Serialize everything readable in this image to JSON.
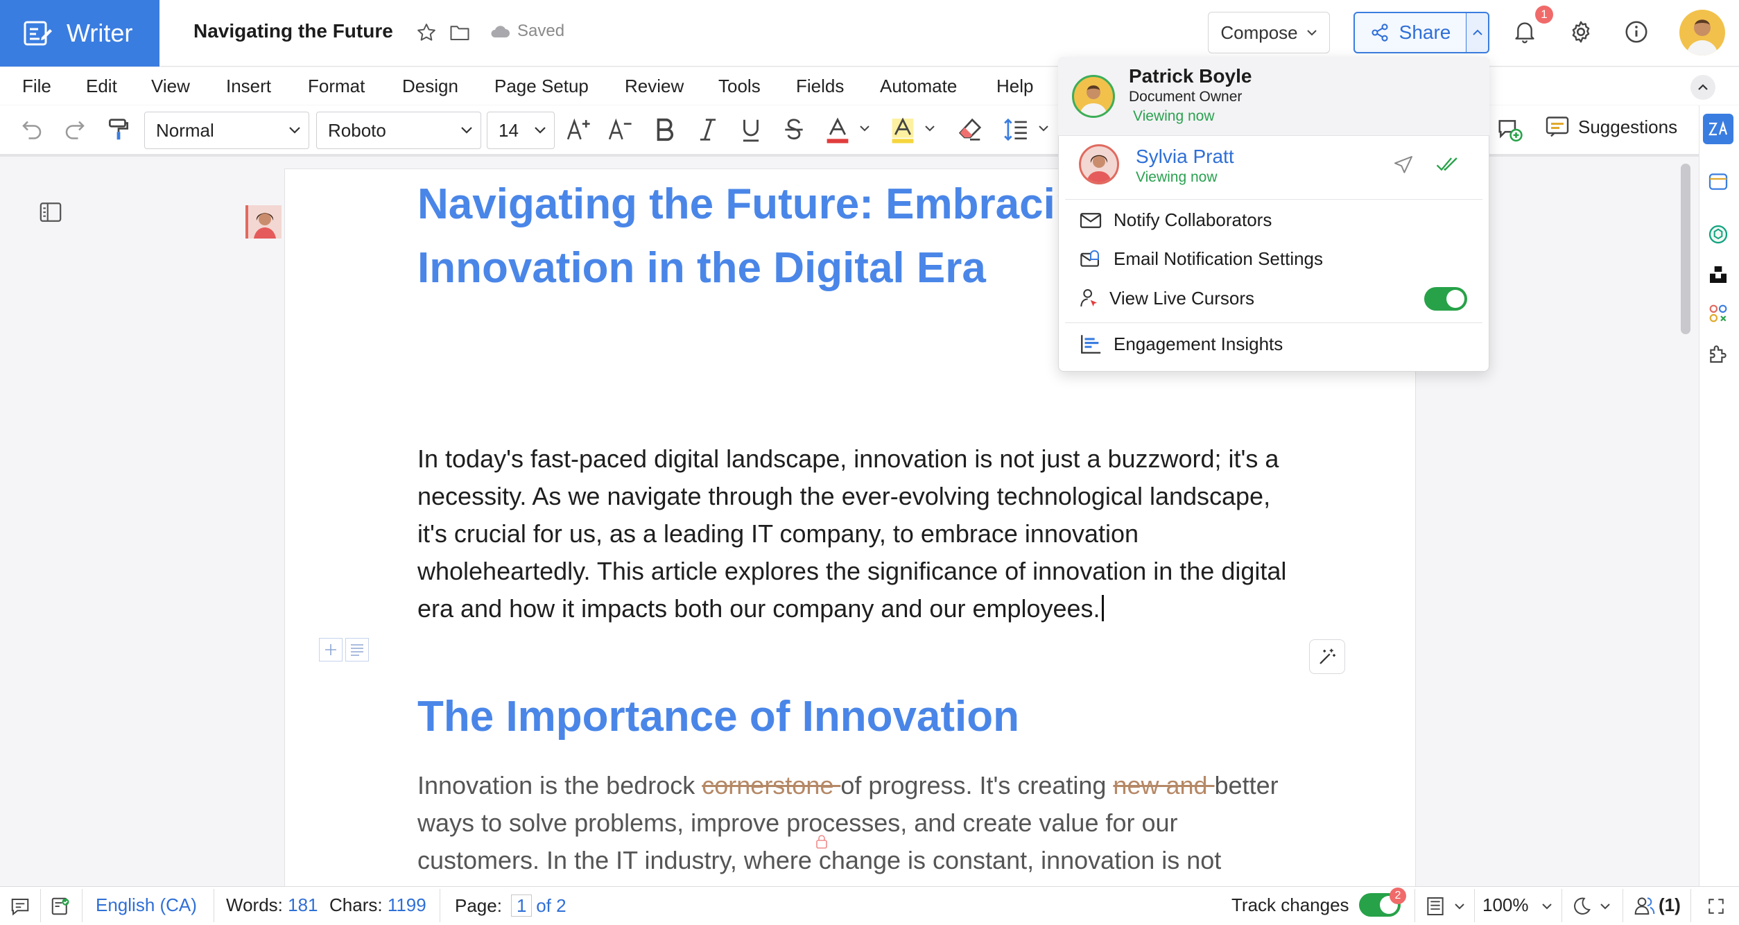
{
  "app": {
    "name": "Writer",
    "doc_title": "Navigating the Future",
    "save_status": "Saved"
  },
  "header": {
    "compose_label": "Compose",
    "share_label": "Share",
    "notification_count": "1"
  },
  "menu": [
    "File",
    "Edit",
    "View",
    "Insert",
    "Format",
    "Design",
    "Page Setup",
    "Review",
    "Tools",
    "Fields",
    "Automate",
    "Help"
  ],
  "toolbar": {
    "style": "Normal",
    "font": "Roboto",
    "size": "14",
    "suggestions_label": "Suggestions",
    "font_color": "#e03c3c",
    "highlight_color": "#f5d63d"
  },
  "share_popup": {
    "owner": {
      "name": "Patrick Boyle",
      "role": "Document Owner",
      "status": "Viewing now"
    },
    "collaborator": {
      "name": "Sylvia Pratt",
      "status": "Viewing now"
    },
    "items": [
      "Notify Collaborators",
      "Email Notification Settings",
      "View Live Cursors",
      "Engagement Insights"
    ],
    "live_cursors_enabled": true
  },
  "document": {
    "heading1": "Navigating the Future: Embracing Innovation in the Digital Era",
    "heading1_line1": "Navigating the Future: Embracin",
    "heading1_line2": "Innovation in the Digital Era",
    "paragraph1": "In today's fast-paced digital landscape, innovation is not just a buzzword; it's a necessity. As we navigate through the ever-evolving technological landscape, it's crucial for us, as a leading IT company, to embrace innovation wholeheartedly. This article explores the significance of innovation in the digital era and how it impacts both our company and our employees.",
    "heading2": "The Importance of Innovation",
    "para2_a": "Innovation is the bedrock ",
    "para2_strike1": "cornerstone ",
    "para2_b": "of progress. It's creating ",
    "para2_strike2": "new and ",
    "para2_c": "better ways to solve problems, improve processes, and create value for our customers. In the IT industry, where change is constant, innovation is not"
  },
  "statusbar": {
    "language": "English (CA)",
    "words_label": "Words:",
    "words": "181",
    "chars_label": "Chars:",
    "chars": "1199",
    "page_label": "Page:",
    "page_current": "1",
    "page_total": "of 2",
    "track_changes_label": "Track changes",
    "track_changes_count": "2",
    "zoom": "100%",
    "collaborators": "(1)"
  },
  "colors": {
    "brand": "#3a7de0",
    "heading": "#4a86e8",
    "success": "#27a248",
    "badge": "#f06a6a"
  }
}
